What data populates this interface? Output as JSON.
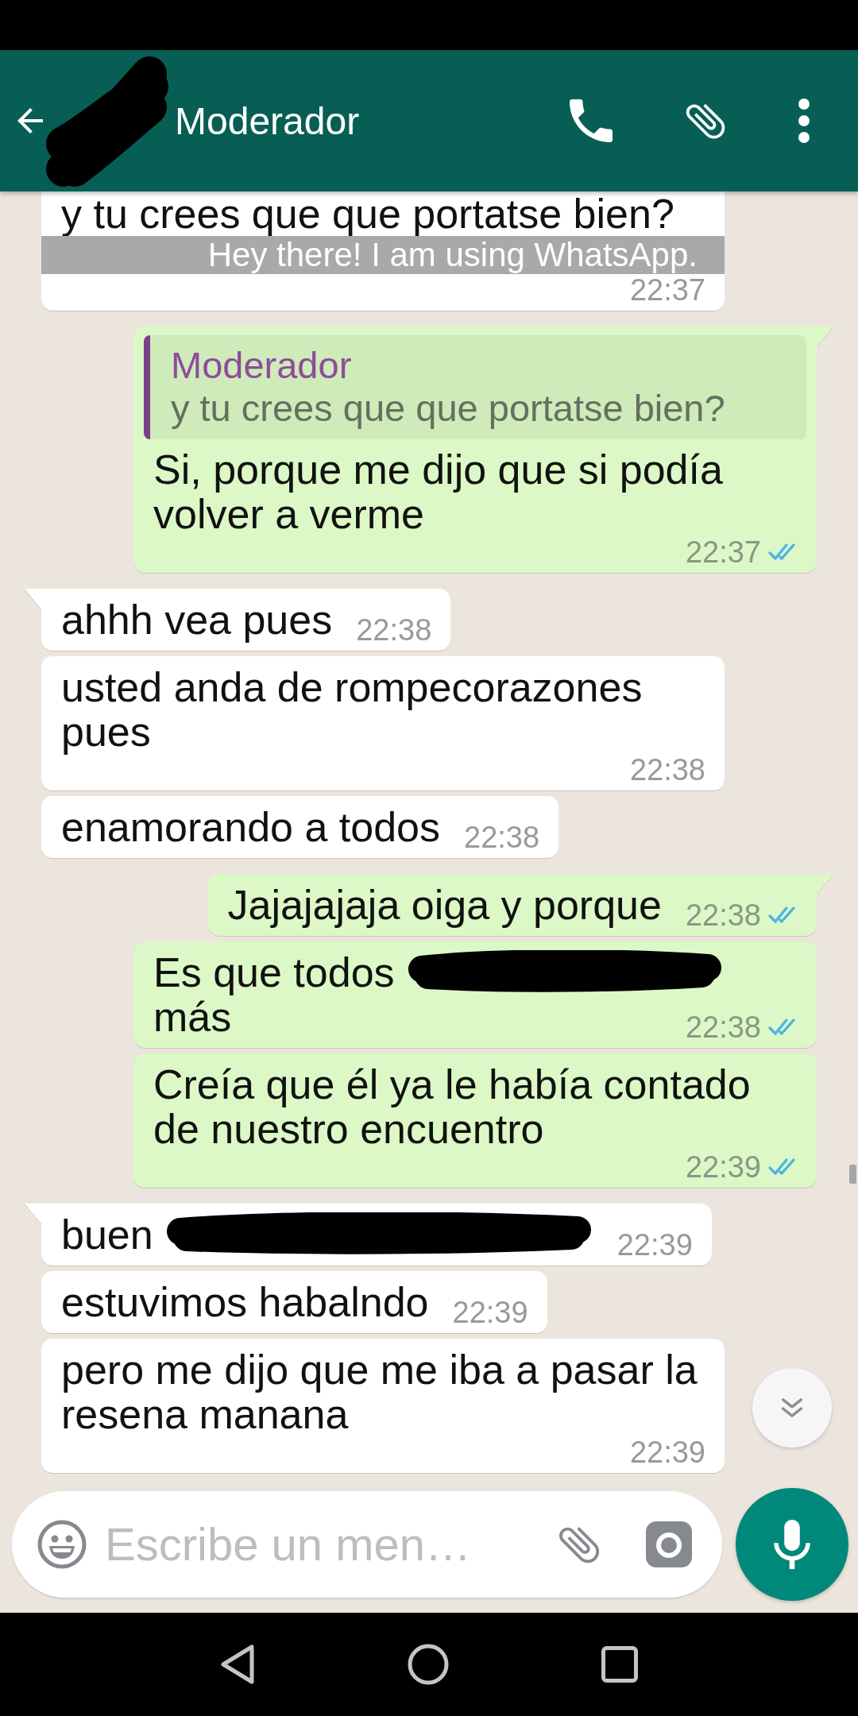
{
  "header": {
    "title": "Moderador",
    "redacted": true
  },
  "status_toast": "Hey there! I am using WhatsApp.",
  "messages": [
    {
      "kind": "incoming",
      "tail": false,
      "cut_off": true,
      "parts": [
        {
          "kind": "text",
          "text": "y tu crees que que portatse bien?"
        }
      ],
      "time": "22:37"
    },
    {
      "kind": "outgoing",
      "tail": true,
      "cut_off": false,
      "quote": {
        "author": "Moderador",
        "text": "y tu crees que que portatse bien?"
      },
      "parts": [
        {
          "kind": "text",
          "text": "Si, porque me dijo que si podía volver a verme"
        }
      ],
      "time": "22:37",
      "read": true
    },
    {
      "kind": "incoming",
      "tail": true,
      "cut_off": false,
      "parts": [
        {
          "kind": "text",
          "text": "ahhh vea pues"
        }
      ],
      "time": "22:38"
    },
    {
      "kind": "incoming",
      "tail": false,
      "cut_off": false,
      "parts": [
        {
          "kind": "text",
          "text": "usted anda de rompecorazones pues"
        }
      ],
      "time": "22:38"
    },
    {
      "kind": "incoming",
      "tail": false,
      "cut_off": false,
      "parts": [
        {
          "kind": "text",
          "text": "enamorando a todos"
        }
      ],
      "time": "22:38"
    },
    {
      "kind": "outgoing",
      "tail": true,
      "cut_off": false,
      "parts": [
        {
          "kind": "text",
          "text": "Jajajajaja oiga y porque"
        }
      ],
      "time": "22:38",
      "read": true
    },
    {
      "kind": "outgoing",
      "tail": false,
      "cut_off": false,
      "parts": [
        {
          "kind": "text",
          "text": "Es que todos"
        },
        {
          "kind": "redaction"
        },
        {
          "kind": "text",
          "text": "más"
        }
      ],
      "time": "22:38",
      "read": true
    },
    {
      "kind": "outgoing",
      "tail": false,
      "cut_off": false,
      "parts": [
        {
          "kind": "text",
          "text": "Creía que él ya le había contado de nuestro encuentro"
        }
      ],
      "time": "22:39",
      "read": true
    },
    {
      "kind": "incoming",
      "tail": true,
      "cut_off": false,
      "parts": [
        {
          "kind": "text",
          "text": "buen"
        },
        {
          "kind": "redaction"
        }
      ],
      "time": "22:39"
    },
    {
      "kind": "incoming",
      "tail": false,
      "cut_off": false,
      "parts": [
        {
          "kind": "text",
          "text": "estuvimos habalndo"
        }
      ],
      "time": "22:39"
    },
    {
      "kind": "incoming",
      "tail": false,
      "cut_off": false,
      "parts": [
        {
          "kind": "text",
          "text": "pero me dijo que me iba a pasar la resena manana"
        }
      ],
      "time": "22:39"
    }
  ],
  "composer": {
    "placeholder": "Escribe un men…"
  }
}
